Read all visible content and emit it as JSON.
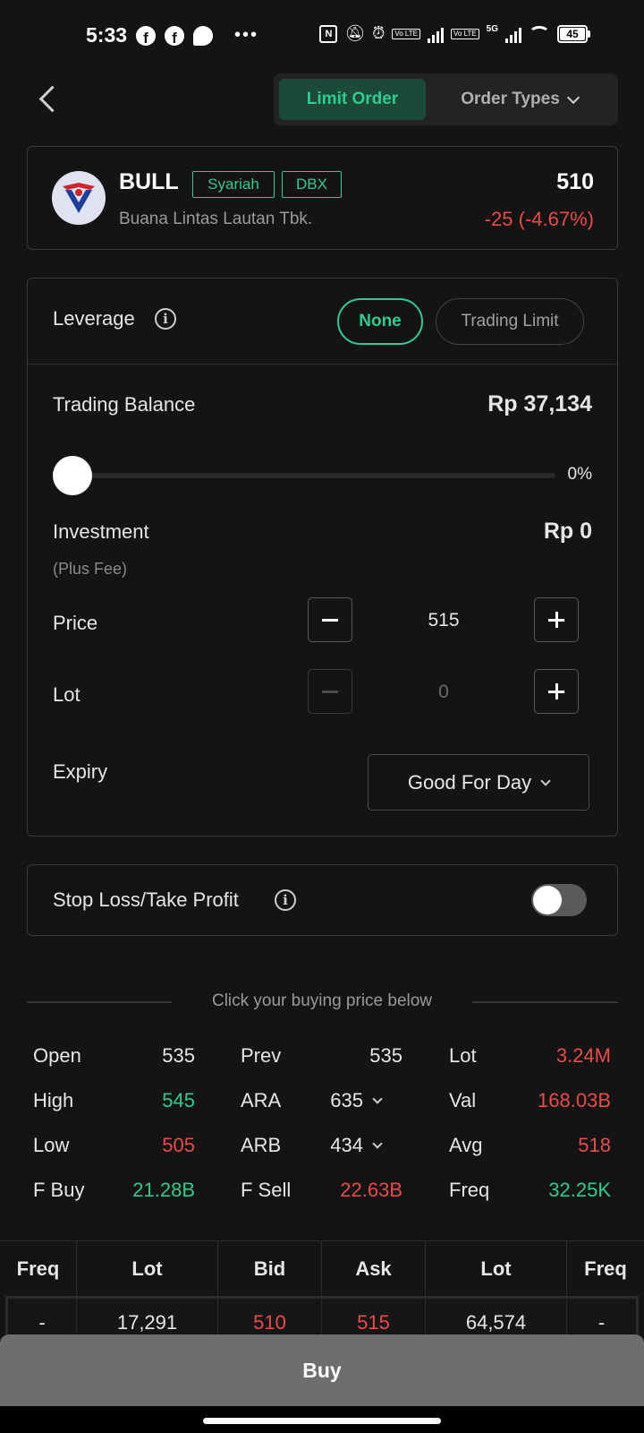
{
  "status_bar": {
    "time": "5:33",
    "app_icons": [
      "facebook-icon",
      "facebook-icon",
      "messenger-icon"
    ],
    "more": "•••",
    "nfc": "N",
    "lte1": "Vo LTE",
    "lte2": "Vo LTE",
    "network": "5G",
    "battery": "45"
  },
  "header": {
    "active_tab": "Limit Order",
    "other_tab": "Order Types"
  },
  "stock": {
    "ticker": "BULL",
    "tags": [
      "Syariah",
      "DBX"
    ],
    "company": "Buana Lintas Lautan Tbk.",
    "price": "510",
    "change": "-25 (-4.67%)",
    "colors": {
      "down": "#e94b4b",
      "up": "#2ecc8e"
    }
  },
  "order": {
    "leverage_label": "Leverage",
    "leverage_options": [
      "None",
      "Trading Limit"
    ],
    "leverage_selected": "None",
    "trading_balance_label": "Trading Balance",
    "trading_balance_value": "Rp 37,134",
    "slider_percent": "0%",
    "investment_label": "Investment",
    "investment_sub": "(Plus Fee)",
    "investment_value": "Rp 0",
    "price_label": "Price",
    "price_value": "515",
    "lot_label": "Lot",
    "lot_value": "0",
    "expiry_label": "Expiry",
    "expiry_value": "Good For Day"
  },
  "sltp": {
    "label": "Stop Loss/Take Profit",
    "enabled": false
  },
  "hint": "Click your buying price below",
  "stats": [
    [
      {
        "k": "Open",
        "v": "535",
        "c": "w"
      },
      {
        "k": "Prev",
        "v": "535",
        "c": "w"
      },
      {
        "k": "Lot",
        "v": "3.24M",
        "c": "r"
      }
    ],
    [
      {
        "k": "High",
        "v": "545",
        "c": "g"
      },
      {
        "k": "ARA",
        "v": "635",
        "c": "w",
        "dropdown": true
      },
      {
        "k": "Val",
        "v": "168.03B",
        "c": "r"
      }
    ],
    [
      {
        "k": "Low",
        "v": "505",
        "c": "r"
      },
      {
        "k": "ARB",
        "v": "434",
        "c": "w",
        "dropdown": true
      },
      {
        "k": "Avg",
        "v": "518",
        "c": "r"
      }
    ],
    [
      {
        "k": "F Buy",
        "v": "21.28B",
        "c": "g"
      },
      {
        "k": "F Sell",
        "v": "22.63B",
        "c": "r"
      },
      {
        "k": "Freq",
        "v": "32.25K",
        "c": "g"
      }
    ]
  ],
  "order_book": {
    "headers": [
      "Freq",
      "Lot",
      "Bid",
      "Ask",
      "Lot",
      "Freq"
    ],
    "rows": [
      [
        "-",
        "17,291",
        "510",
        "515",
        "64,574",
        "-"
      ]
    ]
  },
  "buy_label": "Buy"
}
